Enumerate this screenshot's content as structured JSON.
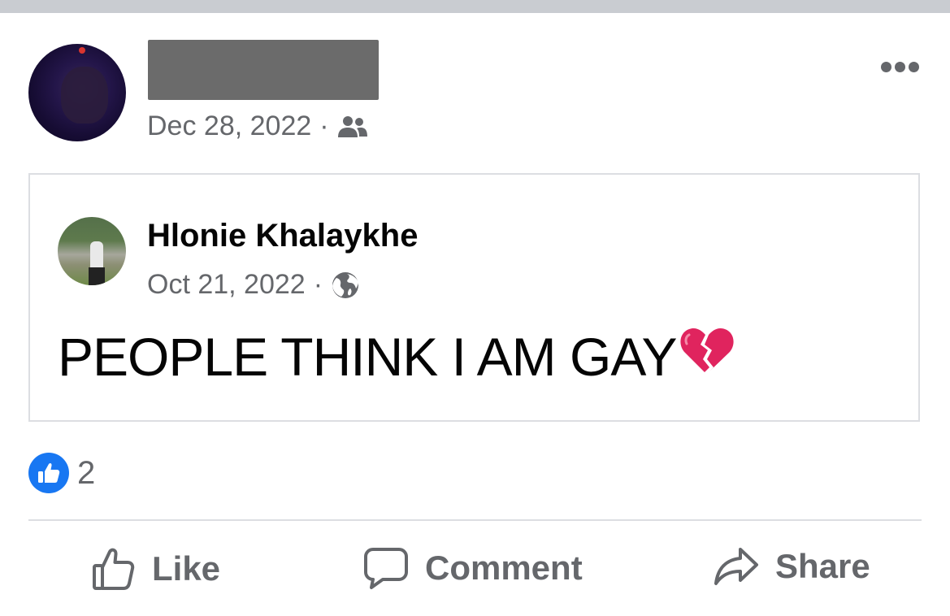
{
  "post": {
    "date": "Dec 28, 2022",
    "separator": "·",
    "audience_icon": "friends-icon"
  },
  "shared_post": {
    "author": "Hlonie Khalaykhe",
    "date": "Oct 21, 2022",
    "separator": "·",
    "audience_icon": "globe-icon",
    "text": "PEOPLE THINK I AM GAY",
    "emoji": "broken-heart-icon"
  },
  "reactions": {
    "icon": "like-reaction-icon",
    "count": "2"
  },
  "actions": {
    "like_label": "Like",
    "comment_label": "Comment",
    "share_label": "Share"
  },
  "colors": {
    "accent": "#1877f2",
    "secondary_text": "#65676b",
    "broken_heart": "#e0245e"
  }
}
